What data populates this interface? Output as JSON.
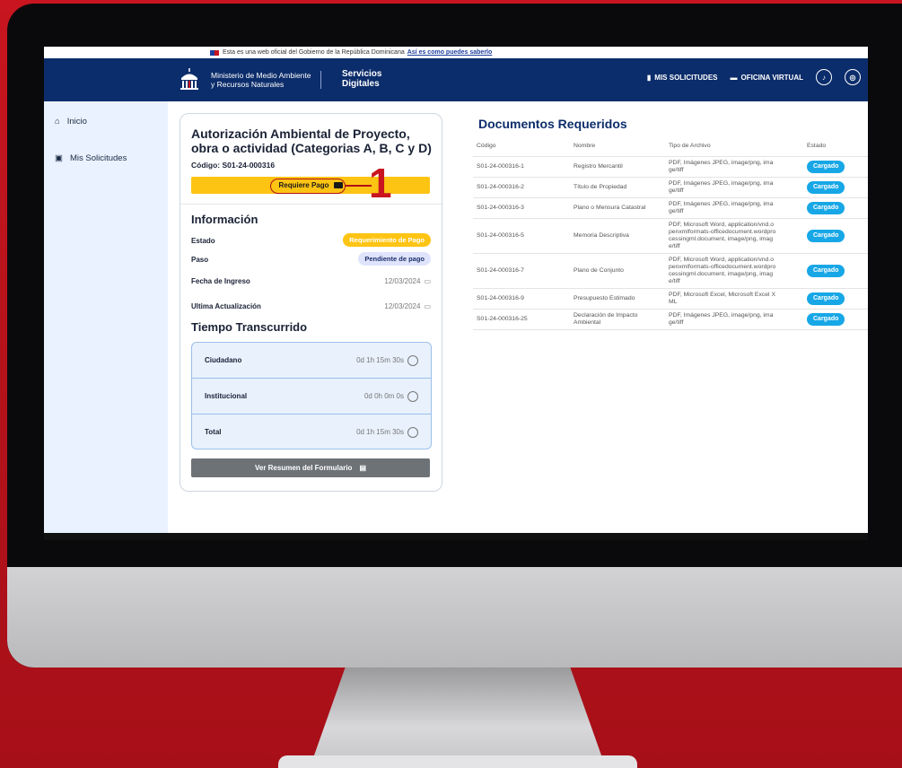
{
  "gov_bar": {
    "text": "Esta es una web oficial del Gobierno de la República Dominicana",
    "link": "Así es como puedes saberlo"
  },
  "header": {
    "ministry": [
      "Ministerio de Medio Ambiente",
      "y Recursos Naturales"
    ],
    "services": [
      "Servicios",
      "Digitales"
    ],
    "nav": [
      "MIS SOLICITUDES",
      "OFICINA VIRTUAL"
    ]
  },
  "sidebar": {
    "items": [
      {
        "label": "Inicio",
        "icon": "home-icon"
      },
      {
        "label": "Mis Solicitudes",
        "icon": "requests-icon"
      }
    ]
  },
  "card": {
    "title": "Autorización Ambiental de Proyecto, obra o actividad (Categorias A, B, C y D)",
    "code": "Código: S01-24-000316",
    "pay_button": "Requiere Pago",
    "callout": "1",
    "info_title": "Información",
    "estado_label": "Estado",
    "estado_value": "Requerimiento de Pago",
    "paso_label": "Paso",
    "paso_value": "Pendiente de pago",
    "ingreso_label": "Fecha de Ingreso",
    "ingreso_value": "12/03/2024",
    "actualizacion_label": "Ultima Actualización",
    "actualizacion_value": "12/03/2024",
    "tiempo_title": "Tiempo Transcurrido",
    "tiempo": [
      {
        "label": "Ciudadano",
        "value": "0d 1h 15m 30s"
      },
      {
        "label": "Institucional",
        "value": "0d 0h 0m 0s"
      },
      {
        "label": "Total",
        "value": "0d 1h 15m 30s"
      }
    ],
    "summary_button": "Ver Resumen del Formulario"
  },
  "docs": {
    "title": "Documentos Requeridos",
    "headers": [
      "Código",
      "Nombre",
      "Tipo de Archivo",
      "Estado"
    ],
    "rows": [
      {
        "code": "S01-24-000316-1",
        "name": "Registro Mercantil",
        "type": "PDF, Imágenes JPEG, image/png, image/tiff",
        "status": "Cargado"
      },
      {
        "code": "S01-24-000316-2",
        "name": "Título de Propiedad",
        "type": "PDF, Imágenes JPEG, image/png, image/tiff",
        "status": "Cargado"
      },
      {
        "code": "S01-24-000316-3",
        "name": "Plano o Mensura Catastral",
        "type": "PDF, Imágenes JPEG, image/png, image/tiff",
        "status": "Cargado"
      },
      {
        "code": "S01-24-000316-5",
        "name": "Memoria Descriptiva",
        "type": "PDF, Microsoft Word, application/vnd.openxmlformats-officedocument.wordprocessingml.document, image/png, image/tiff",
        "status": "Cargado"
      },
      {
        "code": "S01-24-000316-7",
        "name": "Plano de Conjunto",
        "type": "PDF, Microsoft Word, application/vnd.openxmlformats-officedocument.wordprocessingml.document, image/png, image/tiff",
        "status": "Cargado"
      },
      {
        "code": "S01-24-000316-9",
        "name": "Presupuesto Estimado",
        "type": "PDF, Microsoft Excel, Microsoft Excel XML",
        "status": "Cargado"
      },
      {
        "code": "S01-24-000316-25",
        "name": "Declaración de Impacto Ambiental",
        "type": "PDF, Imágenes JPEG, image/png, image/tiff",
        "status": "Cargado"
      }
    ]
  },
  "colors": {
    "background": "#c8151f",
    "navy": "#0c2d6b",
    "yellow": "#fdc413",
    "badge": "#17a7e6",
    "callout": "#c8151f"
  }
}
